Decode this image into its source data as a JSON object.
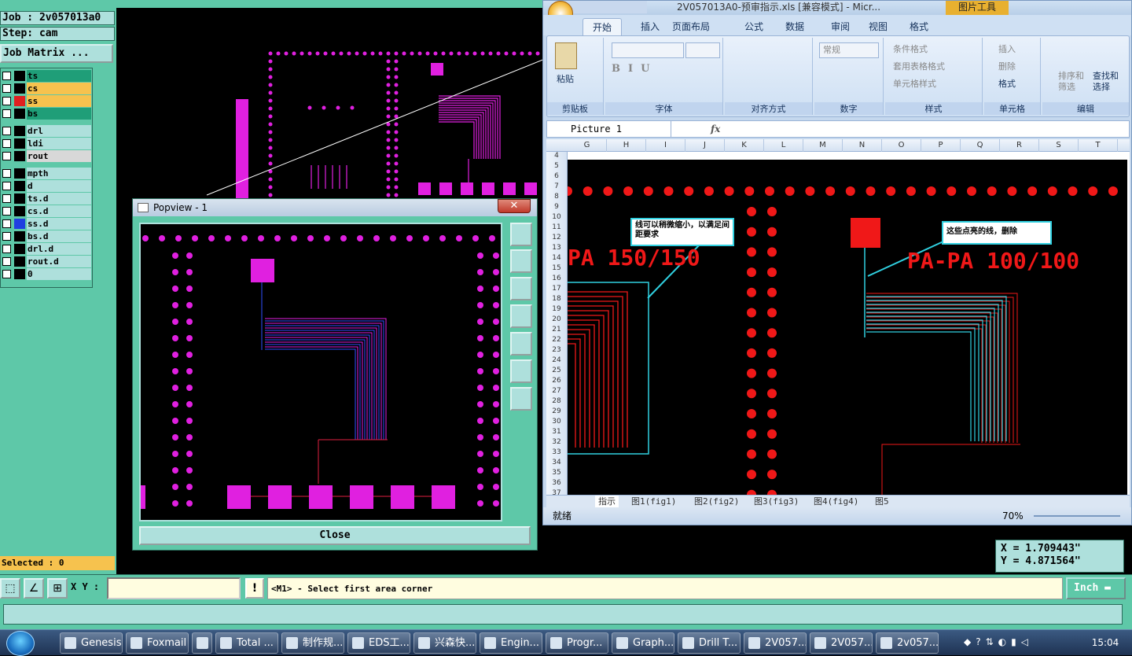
{
  "genesis": {
    "job": "Job : 2v057013a0",
    "step": "Step: cam",
    "job_matrix_label": "Job Matrix ...",
    "layers": [
      {
        "name": "ts",
        "color": "#1f9e78",
        "mark": ""
      },
      {
        "name": "cs",
        "color": "#f6c24e",
        "mark": ""
      },
      {
        "name": "ss",
        "color": "#f6c24e",
        "mark": "red"
      },
      {
        "name": "bs",
        "color": "#1f9e78",
        "mark": ""
      },
      {
        "name": "drl",
        "color": "#aee0dc",
        "mark": ""
      },
      {
        "name": "ldi",
        "color": "#aee0dc",
        "mark": ""
      },
      {
        "name": "rout",
        "color": "#d8d8d8",
        "mark": ""
      },
      {
        "name": "mpth",
        "color": "#aee0dc",
        "mark": ""
      },
      {
        "name": "d",
        "color": "#aee0dc",
        "mark": ""
      },
      {
        "name": "ts.d",
        "color": "#aee0dc",
        "mark": ""
      },
      {
        "name": "cs.d",
        "color": "#aee0dc",
        "mark": ""
      },
      {
        "name": "ss.d",
        "color": "#aee0dc",
        "mark": "blue"
      },
      {
        "name": "bs.d",
        "color": "#aee0dc",
        "mark": ""
      },
      {
        "name": "drl.d",
        "color": "#aee0dc",
        "mark": ""
      },
      {
        "name": "rout.d",
        "color": "#aee0dc",
        "mark": ""
      },
      {
        "name": "0",
        "color": "#aee0dc",
        "mark": ""
      }
    ],
    "selected": "Selected : 0",
    "xy_label": "X Y :",
    "xy_value": "",
    "message": "<M1> - Select first area corner",
    "unit": "Inch",
    "coord_x": "X = 1.709443\"",
    "coord_y": "Y = 4.871564\""
  },
  "popview": {
    "title": "Popview - 1",
    "close_label": "Close",
    "close_x": "✕"
  },
  "excel": {
    "title": "2V057013A0-预审指示.xls  [兼容模式] - Micr...",
    "tools_label": "图片工具",
    "tabs": [
      "开始",
      "插入",
      "页面布局",
      "公式",
      "数据",
      "审阅",
      "视图",
      "格式"
    ],
    "groups": {
      "clipboard": "剪贴板",
      "paste": "粘贴",
      "font": "字体",
      "align": "对齐方式",
      "number": "数字",
      "number_format": "常规",
      "styles": "样式",
      "cond_format": "条件格式",
      "table_format": "套用表格格式",
      "cell_style": "单元格样式",
      "cells": "单元格",
      "insert": "插入",
      "delete": "删除",
      "format": "格式",
      "edit": "编辑",
      "sort": "排序和筛选",
      "find": "查找和选择"
    },
    "name_box": "Picture 1",
    "fx": "fx",
    "columns": [
      "G",
      "H",
      "I",
      "J",
      "K",
      "L",
      "M",
      "N",
      "O",
      "P",
      "Q",
      "R",
      "S",
      "T"
    ],
    "rows": [
      "4",
      "5",
      "6",
      "7",
      "8",
      "9",
      "10",
      "11",
      "12",
      "13",
      "14",
      "15",
      "16",
      "17",
      "18",
      "19",
      "20",
      "21",
      "22",
      "23",
      "24",
      "25",
      "26",
      "27",
      "28",
      "29",
      "30",
      "31",
      "32",
      "33",
      "34",
      "35",
      "36",
      "37"
    ],
    "picture": {
      "note_left": "线可以稍微缩小，以满足间距要求",
      "note_right": "这些点亮的线，删除",
      "label_left": "PA 150/150",
      "label_right": "PA-PA 100/100"
    },
    "sheet_tabs": [
      "指示",
      "图1(fig1)",
      "图2(fig2)",
      "图3(fig3)",
      "图4(fig4)",
      "图5"
    ],
    "status": "就绪",
    "zoom": "70%"
  },
  "taskbar": {
    "items": [
      "Genesis",
      "Foxmail",
      "",
      "Total ...",
      "制作规...",
      "EDS工...",
      "兴森快...",
      "Engin...",
      "Progr...",
      "Graph...",
      "Drill T...",
      "2V057...",
      "2V057...",
      "2v057..."
    ],
    "time": "15:04"
  }
}
